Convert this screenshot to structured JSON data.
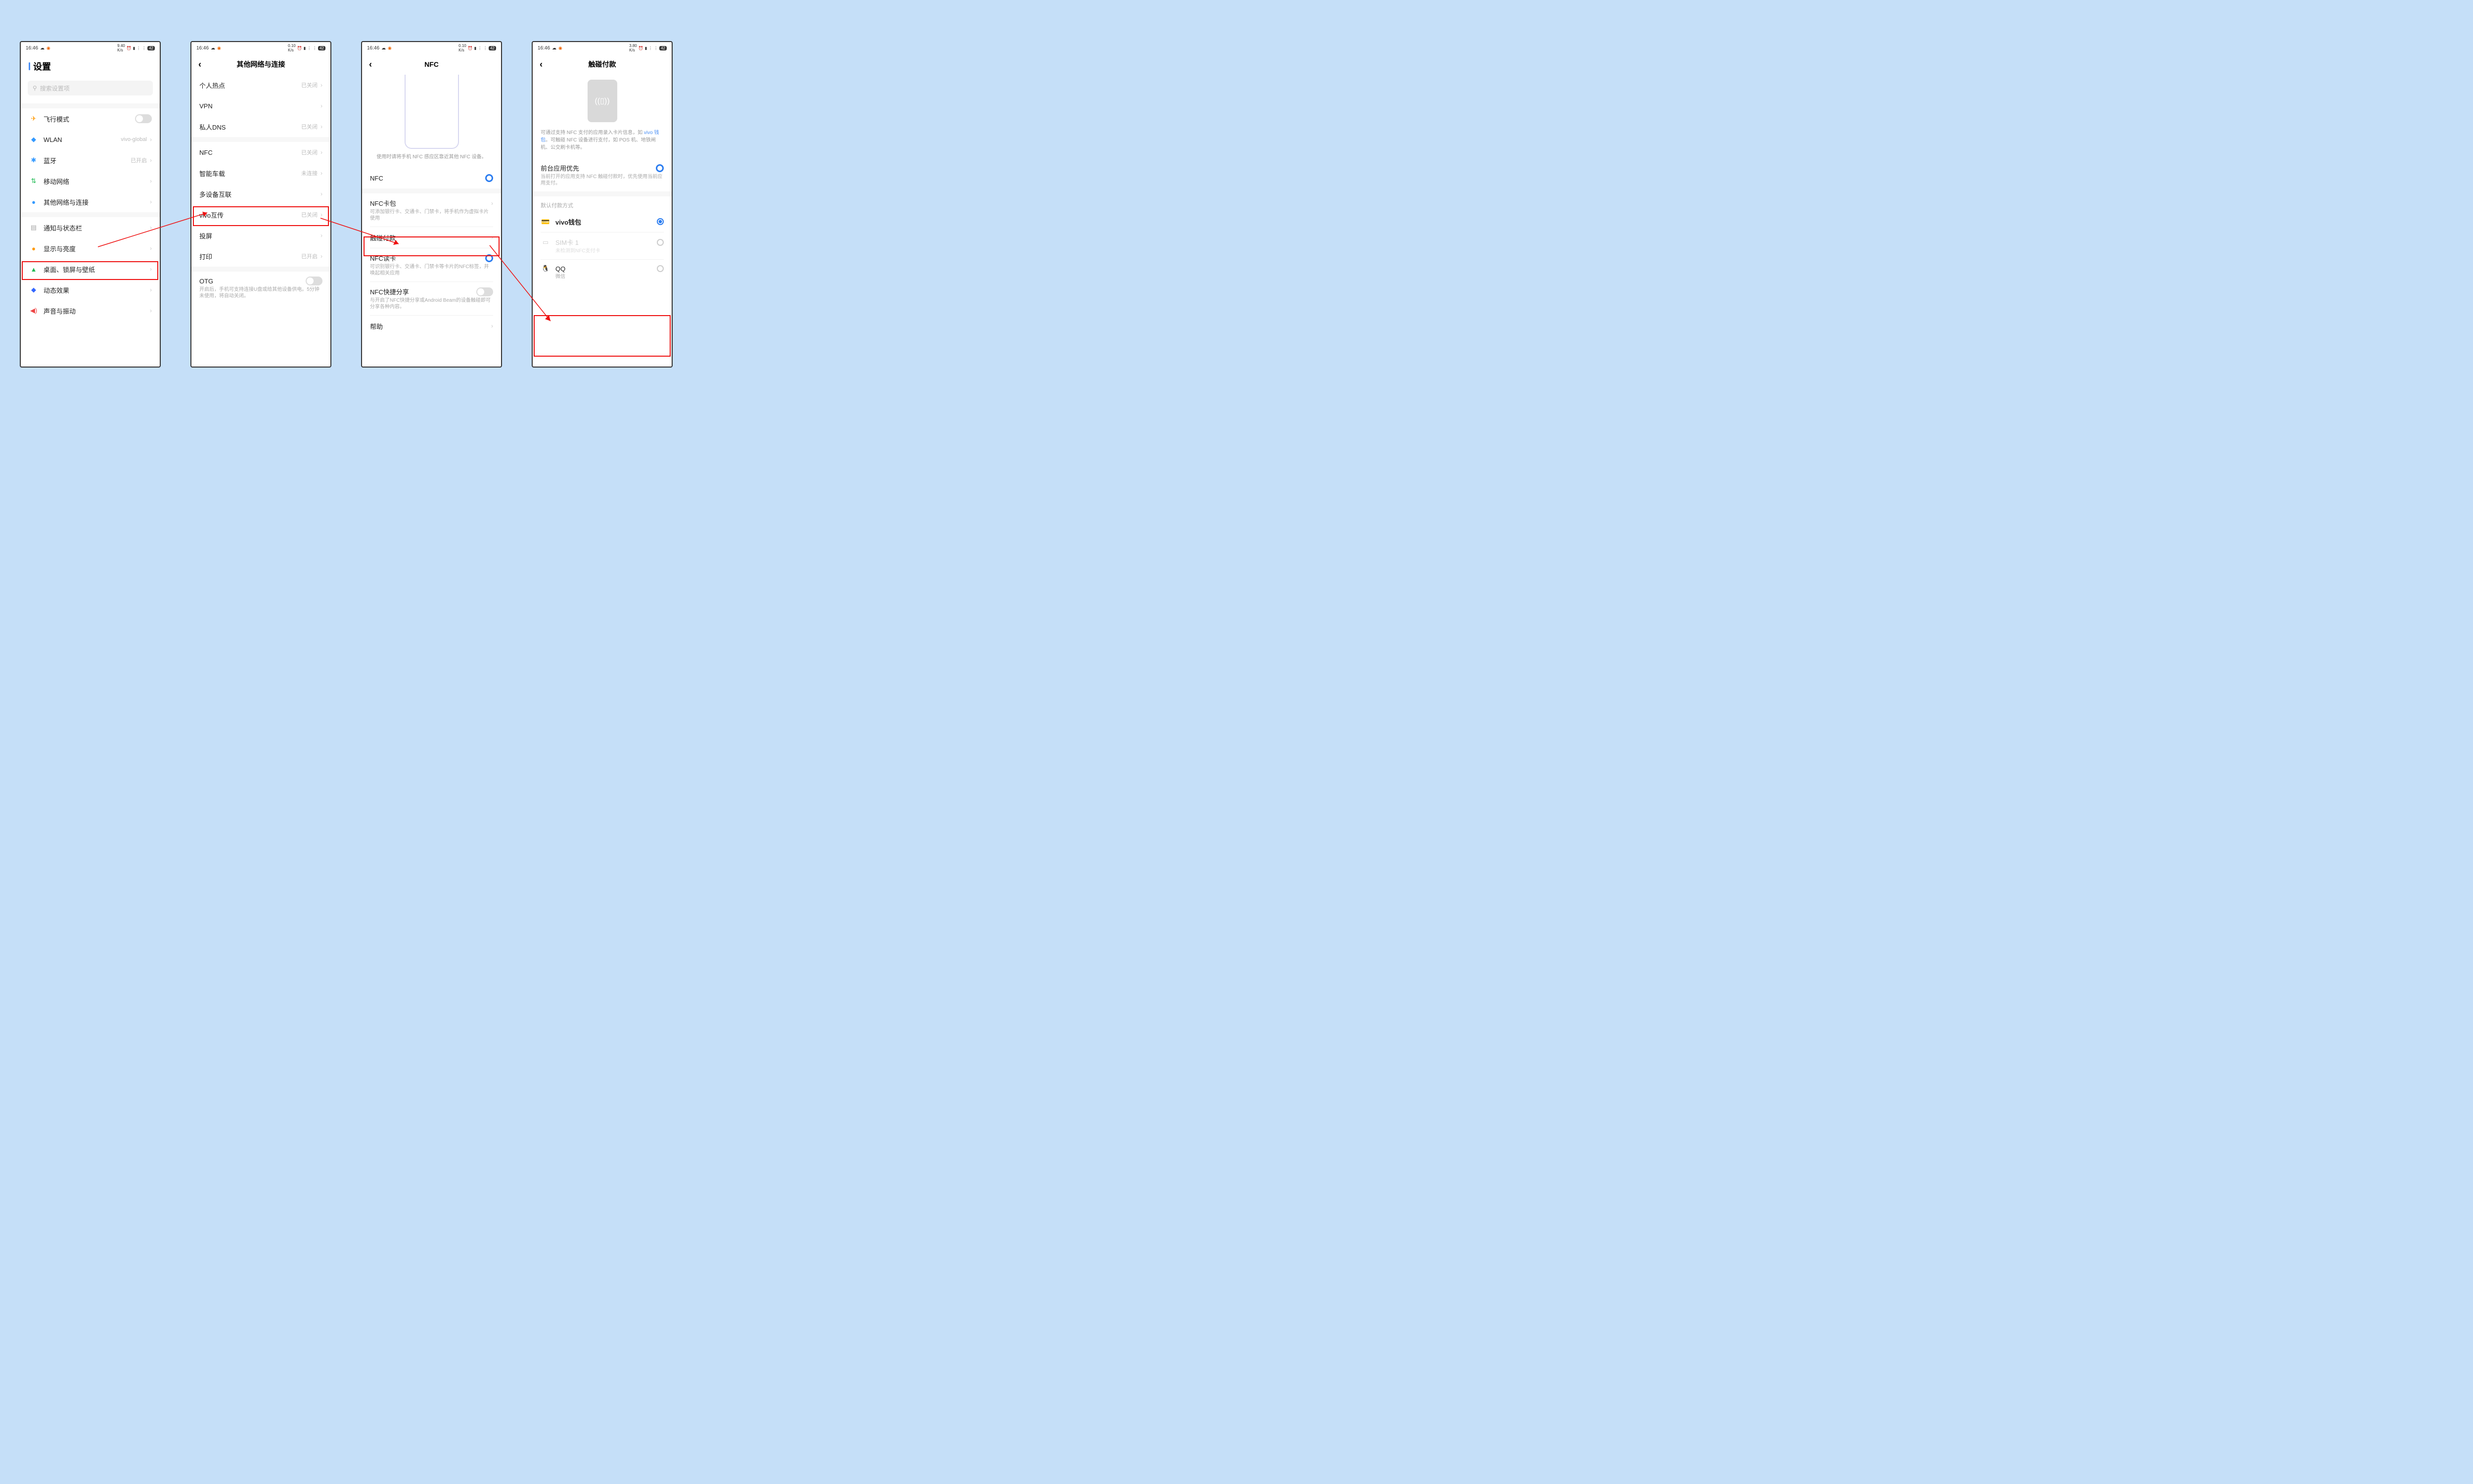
{
  "status": {
    "time": "16:46",
    "battery": "42"
  },
  "p1": {
    "title": "设置",
    "search": "搜索设置项",
    "airplane": "飞行模式",
    "wlan": "WLAN",
    "wlan_v": "vivo-global",
    "bt": "蓝牙",
    "bt_v": "已开启",
    "mobile": "移动网络",
    "other": "其他网络与连接",
    "notif": "通知与状态栏",
    "display": "显示与亮度",
    "home": "桌面、锁屏与壁纸",
    "anim": "动态效果",
    "sound": "声音与振动"
  },
  "p2": {
    "title": "其他网络与连接",
    "hotspot": "个人热点",
    "hotspot_v": "已关闭",
    "vpn": "VPN",
    "dns": "私人DNS",
    "dns_v": "已关闭",
    "nfc": "NFC",
    "nfc_v": "已关闭",
    "car": "智能车载",
    "car_v": "未连接",
    "multi": "多设备互联",
    "vivoshare": "vivo互传",
    "vivoshare_v": "已关闭",
    "cast": "投屏",
    "print": "打印",
    "print_v": "已开启",
    "otg": "OTG",
    "otg_sub": "开启后，手机可支持连接U盘或给其他设备供电。5分钟未使用，将自动关闭。"
  },
  "p3": {
    "title": "NFC",
    "tip": "使用时请将手机 NFC 感应区靠近其他 NFC 设备。",
    "nfc": "NFC",
    "wallet": "NFC卡包",
    "wallet_sub": "可添加银行卡、交通卡、门禁卡，将手机作为虚拟卡片使用",
    "tap": "触碰付款",
    "read": "NFC读卡",
    "read_sub": "可识别银行卡、交通卡、门禁卡等卡片的NFC标签，并唤起相关应用",
    "share": "NFC快捷分享",
    "share_sub": "与开启了NFC快捷分享或Android Beam的设备触碰即可分享各种内容。",
    "help": "帮助"
  },
  "p4": {
    "title": "触碰付款",
    "desc1": "可通过支持 NFC 支付的应用录入卡片信息，如 ",
    "desc_lk": "vivo 钱包",
    "desc2": "。可触碰 NFC 设备进行支付，如 POS 机、地铁闸机、公交刷卡机等。",
    "fg": "前台应用优先",
    "fg_sub": "当前打开的应用支持 NFC 触碰付款时，优先使用当前应用支付。",
    "default_lbl": "默认付款方式",
    "vivo": "vivo钱包",
    "sim": "SIM卡 1",
    "sim_sub": "未检测到NFC支付卡",
    "qq": "QQ",
    "qq_sub": "微信"
  }
}
